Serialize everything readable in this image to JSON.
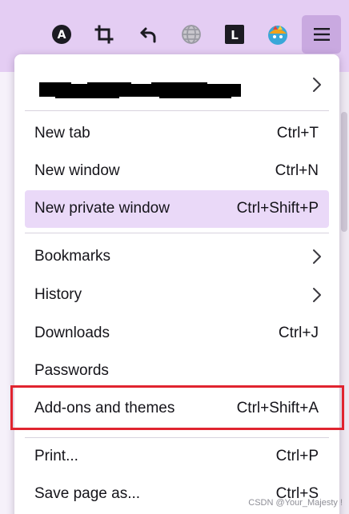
{
  "toolbar": {
    "icons": [
      {
        "name": "account-a-icon",
        "glyph": "A"
      },
      {
        "name": "crop-icon"
      },
      {
        "name": "undo-icon"
      },
      {
        "name": "globe-icon"
      },
      {
        "name": "extension-l-icon",
        "glyph": "L"
      },
      {
        "name": "colorful-extension-icon"
      }
    ],
    "menu_icon": "hamburger-menu-icon",
    "accent_color": "#e4cdf3"
  },
  "menu": {
    "account_name_redacted": true,
    "items": [
      {
        "label": "New tab",
        "shortcut": "Ctrl+T"
      },
      {
        "label": "New window",
        "shortcut": "Ctrl+N"
      },
      {
        "label": "New private window",
        "shortcut": "Ctrl+Shift+P",
        "highlighted": true
      },
      {
        "label": "Bookmarks",
        "submenu": true
      },
      {
        "label": "History",
        "submenu": true
      },
      {
        "label": "Downloads",
        "shortcut": "Ctrl+J"
      },
      {
        "label": "Passwords"
      },
      {
        "label": "Add-ons and themes",
        "shortcut": "Ctrl+Shift+A",
        "boxed": true
      },
      {
        "label": "Print...",
        "shortcut": "Ctrl+P"
      },
      {
        "label": "Save page as...",
        "shortcut": "Ctrl+S"
      }
    ],
    "highlight_color": "#ead9f8",
    "box_color": "#e0242f"
  },
  "watermark": "CSDN @Your_Majesty !"
}
